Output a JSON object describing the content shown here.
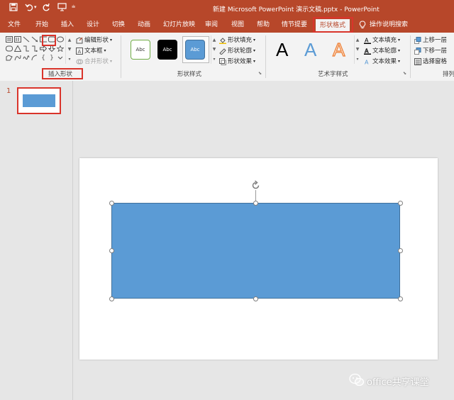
{
  "title_bar": {
    "title": "新建 Microsoft PowerPoint 演示文稿.pptx  -  PowerPoint",
    "qa_customize": "⩧"
  },
  "tabs": [
    {
      "label": "文件"
    },
    {
      "label": "开始"
    },
    {
      "label": "插入"
    },
    {
      "label": "设计"
    },
    {
      "label": "切换"
    },
    {
      "label": "动画"
    },
    {
      "label": "幻灯片放映"
    },
    {
      "label": "审阅"
    },
    {
      "label": "视图"
    },
    {
      "label": "帮助"
    },
    {
      "label": "情节提要"
    },
    {
      "label": "形状格式"
    },
    {
      "label": "操作说明搜索"
    }
  ],
  "ribbon": {
    "insert_shapes": {
      "label": "插入形状",
      "edit_shape": "编辑形状",
      "text_box": "文本框",
      "merge_shapes": "合并形状"
    },
    "shape_styles": {
      "label": "形状样式",
      "style1": "Abc",
      "style2": "Abc",
      "style3": "Abc",
      "fill": "形状填充",
      "outline": "形状轮廓",
      "effects": "形状效果"
    },
    "wordart_styles": {
      "label": "艺术字样式",
      "letter": "A",
      "text_fill": "文本填充",
      "text_outline": "文本轮廓",
      "text_effects": "文本效果"
    },
    "arrange": {
      "label": "排列",
      "bring_forward": "上移一层",
      "send_backward": "下移一层",
      "selection_pane": "选择窗格"
    }
  },
  "slides_panel": {
    "slide_number": "1"
  },
  "watermark": {
    "text": "office共享课堂"
  },
  "colors": {
    "accent": "#b7472a",
    "shape_fill": "#5b9bd5",
    "highlight": "#d9342b"
  }
}
